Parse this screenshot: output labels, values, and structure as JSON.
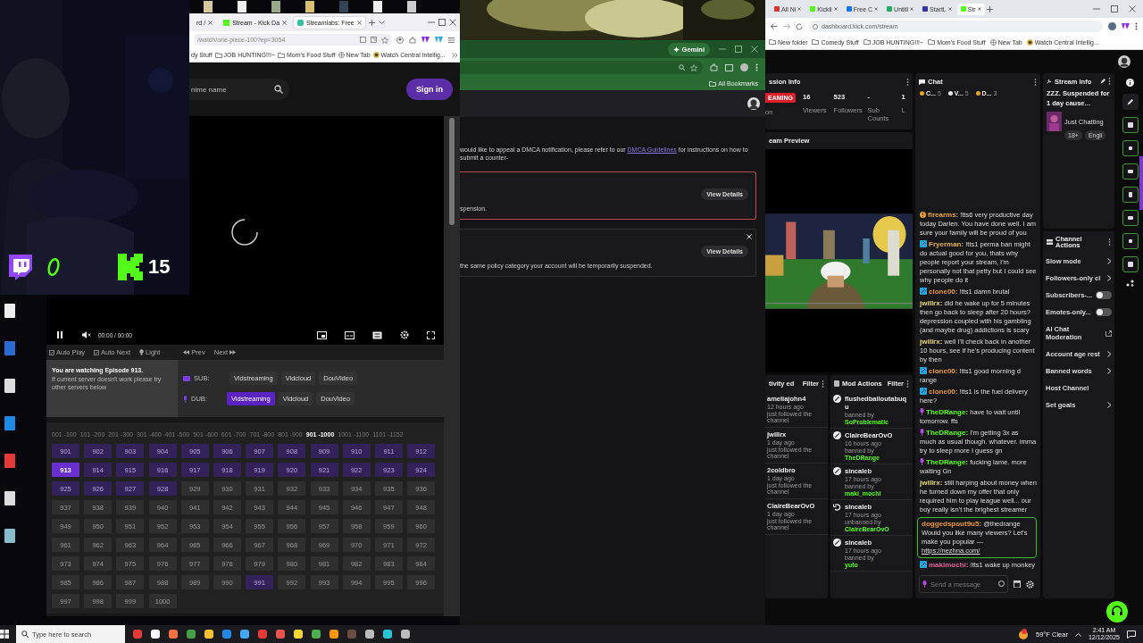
{
  "overlay": {
    "count": "15"
  },
  "player": {
    "tabs": [
      {
        "label": "rd /",
        "selected": false
      },
      {
        "label": "Stream - Kick Da",
        "selected": false
      },
      {
        "label": "Streamlabs: Free",
        "selected": true
      }
    ],
    "url": "/watch/one-piece-100?ep=3054",
    "bookmarks": [
      {
        "label": "dy Stuff",
        "kind": "text"
      },
      {
        "label": "JOB HUNTING!!!~",
        "kind": "folder"
      },
      {
        "label": "Mom's Food Stuff",
        "kind": "folder"
      },
      {
        "label": "New Tab",
        "kind": "globe"
      },
      {
        "label": "Watch Central Intellig...",
        "kind": "site"
      }
    ],
    "search": {
      "placeholder": "nime name"
    },
    "sign_in": "Sign in",
    "time": "00:00 / 00:00",
    "toolbar": [
      {
        "label": "Auto Play",
        "kind": "check"
      },
      {
        "label": "Auto Next",
        "kind": "check"
      },
      {
        "label": "Light",
        "kind": "bulb"
      },
      {
        "label": "Prev",
        "kind": "prev"
      },
      {
        "label": "Next",
        "kind": "next"
      }
    ],
    "notice": {
      "title": "You are watching Episode 913.",
      "text": "If current server doesn't work please try other servers below"
    },
    "servers": [
      {
        "kind": "sub",
        "label": "SUB:",
        "options": [
          {
            "label": "Vidstreaming",
            "selected": false
          },
          {
            "label": "Vidcloud",
            "selected": false
          },
          {
            "label": "DouVideo",
            "selected": false
          }
        ]
      },
      {
        "kind": "dub",
        "label": "DUB:",
        "options": [
          {
            "label": "Vidstreaming",
            "selected": true
          },
          {
            "label": "Vidcloud",
            "selected": false
          },
          {
            "label": "DouVideo",
            "selected": false
          }
        ]
      }
    ],
    "ranges": [
      {
        "label": "001 -100",
        "selected": false
      },
      {
        "label": "101 -200",
        "selected": false
      },
      {
        "label": "201 -300",
        "selected": false
      },
      {
        "label": "301 -400",
        "selected": false
      },
      {
        "label": "401 -500",
        "selected": false
      },
      {
        "label": "501 -600",
        "selected": false
      },
      {
        "label": "601 -700",
        "selected": false
      },
      {
        "label": "701 -800",
        "selected": false
      },
      {
        "label": "801 -900",
        "selected": false
      },
      {
        "label": "901 -1000",
        "selected": true
      },
      {
        "label": "1001 -1100",
        "selected": false
      },
      {
        "label": "1101 -1152",
        "selected": false
      }
    ],
    "episodes": [
      {
        "label": "901",
        "watched": true,
        "selected": false
      },
      {
        "label": "902",
        "watched": true,
        "selected": false
      },
      {
        "label": "903",
        "watched": true,
        "selected": false
      },
      {
        "label": "904",
        "watched": true,
        "selected": false
      },
      {
        "label": "905",
        "watched": true,
        "selected": false
      },
      {
        "label": "906",
        "watched": true,
        "selected": false
      },
      {
        "label": "907",
        "watched": true,
        "selected": false
      },
      {
        "label": "908",
        "watched": true,
        "selected": false
      },
      {
        "label": "909",
        "watched": true,
        "selected": false
      },
      {
        "label": "910",
        "watched": true,
        "selected": false
      },
      {
        "label": "911",
        "watched": true,
        "selected": false
      },
      {
        "label": "912",
        "watched": true,
        "selected": false
      },
      {
        "label": "913",
        "watched": true,
        "selected": true
      },
      {
        "label": "914",
        "watched": true,
        "selected": false
      },
      {
        "label": "915",
        "watched": true,
        "selected": false
      },
      {
        "label": "916",
        "watched": true,
        "selected": false
      },
      {
        "label": "917",
        "watched": true,
        "selected": false
      },
      {
        "label": "918",
        "watched": true,
        "selected": false
      },
      {
        "label": "919",
        "watched": true,
        "selected": false
      },
      {
        "label": "920",
        "watched": true,
        "selected": false
      },
      {
        "label": "921",
        "watched": true,
        "selected": false
      },
      {
        "label": "922",
        "watched": true,
        "selected": false
      },
      {
        "label": "923",
        "watched": true,
        "selected": false
      },
      {
        "label": "924",
        "watched": true,
        "selected": false
      },
      {
        "label": "925",
        "watched": true,
        "selected": false
      },
      {
        "label": "926",
        "watched": true,
        "selected": false
      },
      {
        "label": "927",
        "watched": true,
        "selected": false
      },
      {
        "label": "928",
        "watched": true,
        "selected": false
      },
      {
        "label": "929",
        "watched": false,
        "selected": false
      },
      {
        "label": "930",
        "watched": false,
        "selected": false
      },
      {
        "label": "931",
        "watched": false,
        "selected": false
      },
      {
        "label": "932",
        "watched": false,
        "selected": false
      },
      {
        "label": "933",
        "watched": false,
        "selected": false
      },
      {
        "label": "934",
        "watched": false,
        "selected": false
      },
      {
        "label": "935",
        "watched": false,
        "selected": false
      },
      {
        "label": "936",
        "watched": false,
        "selected": false
      },
      {
        "label": "937",
        "watched": false,
        "selected": false
      },
      {
        "label": "938",
        "watched": false,
        "selected": false
      },
      {
        "label": "939",
        "watched": false,
        "selected": false
      },
      {
        "label": "940",
        "watched": false,
        "selected": false
      },
      {
        "label": "941",
        "watched": false,
        "selected": false
      },
      {
        "label": "942",
        "watched": false,
        "selected": false
      },
      {
        "label": "943",
        "watched": false,
        "selected": false
      },
      {
        "label": "944",
        "watched": false,
        "selected": false
      },
      {
        "label": "945",
        "watched": false,
        "selected": false
      },
      {
        "label": "946",
        "watched": false,
        "selected": false
      },
      {
        "label": "947",
        "watched": false,
        "selected": false
      },
      {
        "label": "948",
        "watched": false,
        "selected": false
      },
      {
        "label": "949",
        "watched": false,
        "selected": false
      },
      {
        "label": "950",
        "watched": false,
        "selected": false
      },
      {
        "label": "951",
        "watched": false,
        "selected": false
      },
      {
        "label": "952",
        "watched": false,
        "selected": false
      },
      {
        "label": "953",
        "watched": false,
        "selected": false
      },
      {
        "label": "954",
        "watched": false,
        "selected": false
      },
      {
        "label": "955",
        "watched": false,
        "selected": false
      },
      {
        "label": "956",
        "watched": false,
        "selected": false
      },
      {
        "label": "957",
        "watched": false,
        "selected": false
      },
      {
        "label": "958",
        "watched": false,
        "selected": false
      },
      {
        "label": "959",
        "watched": false,
        "selected": false
      },
      {
        "label": "960",
        "watched": false,
        "selected": false
      },
      {
        "label": "961",
        "watched": false,
        "selected": false
      },
      {
        "label": "962",
        "watched": false,
        "selected": false
      },
      {
        "label": "963",
        "watched": false,
        "selected": false
      },
      {
        "label": "964",
        "watched": false,
        "selected": false
      },
      {
        "label": "965",
        "watched": false,
        "selected": false
      },
      {
        "label": "966",
        "watched": false,
        "selected": false
      },
      {
        "label": "967",
        "watched": false,
        "selected": false
      },
      {
        "label": "968",
        "watched": false,
        "selected": false
      },
      {
        "label": "969",
        "watched": false,
        "selected": false
      },
      {
        "label": "970",
        "watched": false,
        "selected": false
      },
      {
        "label": "971",
        "watched": false,
        "selected": false
      },
      {
        "label": "972",
        "watched": false,
        "selected": false
      },
      {
        "label": "973",
        "watched": false,
        "selected": false
      },
      {
        "label": "974",
        "watched": false,
        "selected": false
      },
      {
        "label": "975",
        "watched": false,
        "selected": false
      },
      {
        "label": "976",
        "watched": false,
        "selected": false
      },
      {
        "label": "977",
        "watched": false,
        "selected": false
      },
      {
        "label": "978",
        "watched": false,
        "selected": false
      },
      {
        "label": "979",
        "watched": false,
        "selected": false
      },
      {
        "label": "980",
        "watched": false,
        "selected": false
      },
      {
        "label": "981",
        "watched": false,
        "selected": false
      },
      {
        "label": "982",
        "watched": false,
        "selected": false
      },
      {
        "label": "983",
        "watched": false,
        "selected": false
      },
      {
        "label": "984",
        "watched": false,
        "selected": false
      },
      {
        "label": "985",
        "watched": false,
        "selected": false
      },
      {
        "label": "986",
        "watched": false,
        "selected": false
      },
      {
        "label": "987",
        "watched": false,
        "selected": false
      },
      {
        "label": "988",
        "watched": false,
        "selected": false
      },
      {
        "label": "989",
        "watched": false,
        "selected": false
      },
      {
        "label": "990",
        "watched": false,
        "selected": false
      },
      {
        "label": "991",
        "watched": true,
        "selected": false
      },
      {
        "label": "992",
        "watched": false,
        "selected": false
      },
      {
        "label": "993",
        "watched": false,
        "selected": false
      },
      {
        "label": "994",
        "watched": false,
        "selected": false
      },
      {
        "label": "995",
        "watched": false,
        "selected": false
      },
      {
        "label": "996",
        "watched": false,
        "selected": false
      },
      {
        "label": "997",
        "watched": false,
        "selected": false
      },
      {
        "label": "998",
        "watched": false,
        "selected": false
      },
      {
        "label": "999",
        "watched": false,
        "selected": false
      },
      {
        "label": "1000",
        "watched": false,
        "selected": false
      }
    ]
  },
  "dashboard": {
    "gemini": "Gemini",
    "all_bookmarks": "All Bookmarks",
    "notice": "would like to appeal a DMCA notification, please refer to our ",
    "notice_link": "DMCA Guidelines",
    "notice_after": " for instructions on how to submit a counter-",
    "cards": [
      {
        "kind": "alert",
        "button": "View Details",
        "text": "spension.",
        "dismissible": false
      },
      {
        "kind": "warning",
        "button": "View Details",
        "text": "the same policy category your account will be temporarily suspended.",
        "dismissible": true
      }
    ]
  },
  "kick": {
    "tabs": [
      {
        "label": "All Ni",
        "selected": false
      },
      {
        "label": "Kickli",
        "selected": false
      },
      {
        "label": "Free C",
        "selected": false
      },
      {
        "label": "Untitl",
        "selected": false
      },
      {
        "label": "StartL",
        "selected": false
      },
      {
        "label": "Str",
        "selected": true
      }
    ],
    "url": "dashboard.kick.com/stream",
    "bookmarks": [
      {
        "label": "New folder",
        "kind": "folder"
      },
      {
        "label": "Comedy Stuff",
        "kind": "folder"
      },
      {
        "label": "JOB HUNTING!!!~",
        "kind": "folder"
      },
      {
        "label": "Mom's Food Stuff",
        "kind": "folder"
      },
      {
        "label": "New Tab",
        "kind": "globe"
      },
      {
        "label": "Watch Central Intellig...",
        "kind": "site"
      }
    ],
    "session": {
      "title": "ssion Info",
      "badge": "EAMING",
      "badge_sub": "on",
      "stats": [
        {
          "value": "16",
          "label": "Viewers"
        },
        {
          "value": "523",
          "label": "Followers"
        },
        {
          "value": "-",
          "label": "Sub Counts"
        },
        {
          "value": "1",
          "label": "L"
        }
      ]
    },
    "preview_title": "eam Preview",
    "activity": {
      "title": "tivity ed",
      "filter": "Filter",
      "items": [
        {
          "user": "ameliajohn4",
          "time": "12 hours ago",
          "text": "just followed the channel"
        },
        {
          "user": "jwillrx",
          "time": "1 day ago",
          "text": "just followed the channel"
        },
        {
          "user": "2coldbro",
          "time": "1 day ago",
          "text": "just followed the channel"
        },
        {
          "user": "ClaireBearOvO",
          "time": "1 day ago",
          "text": "just followed the channel"
        }
      ]
    },
    "mod_actions": {
      "title": "Mod Actions",
      "filter": "Filter",
      "items": [
        {
          "kind": "ban",
          "user": "flushedbailoutabuqu",
          "action": "banned by",
          "by": "SoProblematic"
        },
        {
          "kind": "ban",
          "user": "ClaireBearOvO",
          "time": "16 hours ago",
          "action": "banned by",
          "by": "TheDRange"
        },
        {
          "kind": "ban",
          "user": "sincaleb",
          "time": "17 hours ago",
          "action": "banned by",
          "by": "maki_mochi"
        },
        {
          "kind": "unban",
          "user": "sincaleb",
          "time": "17 hours ago",
          "action": "unbanned by",
          "by": "ClaireBearOvO"
        },
        {
          "kind": "ban",
          "user": "sincaleb",
          "time": "17 hours ago",
          "action": "banned by",
          "by": "yuto"
        }
      ]
    },
    "chat": {
      "title": "Chat",
      "filters": [
        {
          "label": "C...",
          "count": "5",
          "color": "#e8a020"
        },
        {
          "label": "V...",
          "count": "5",
          "color": "#e6e6e6"
        },
        {
          "label": "D...",
          "count": "3",
          "color": "#e8a020"
        }
      ],
      "messages": [
        {
          "kind": "warn",
          "user": "firearms:",
          "color": "#e8a83a",
          "text": "!tts6 very productive day today Darlen. You have done well. I am sure your family will be proud of you",
          "highlighted": false
        },
        {
          "kind": "mod",
          "user": "Fryerman:",
          "color": "#e0b050",
          "text": "!tts1 perma ban might do actual good for you, thats why people report your stream, I'm personally not that petty but I could see why people do it",
          "highlighted": false
        },
        {
          "kind": "mod",
          "user": "clone00:",
          "color": "#e8963a",
          "text": "!tts1 damn brutal",
          "highlighted": false
        },
        {
          "kind": "none",
          "user": "jwillrx:",
          "color": "#e8d878",
          "text": "did he wake up for 5 minutes then go back to sleep after 20 hours? depression coupled with his gambling (and maybe drug) addictions is scary",
          "highlighted": false
        },
        {
          "kind": "none",
          "user": "jwillrx:",
          "color": "#e8d878",
          "text": "well I'll check back in another 10 hours, see if he's producing content by then",
          "highlighted": false
        },
        {
          "kind": "mod",
          "user": "clone00:",
          "color": "#e8963a",
          "text": "!tts1 good morning d range",
          "highlighted": false
        },
        {
          "kind": "mod",
          "user": "clone00:",
          "color": "#e8963a",
          "text": "!tts1 is the fuel delivery here?",
          "highlighted": false
        },
        {
          "kind": "mic",
          "user": "TheDRange:",
          "color": "#53fc18",
          "text": "have to wait until tomorrow. ffs",
          "highlighted": false
        },
        {
          "kind": "mic",
          "user": "TheDRange:",
          "color": "#53fc18",
          "text": "I'm getting 3x as much as usual though. whatever. imma try to sleep more I guess gn",
          "highlighted": false
        },
        {
          "kind": "mic",
          "user": "TheDRange:",
          "color": "#53fc18",
          "text": "fucking lame. more waiting Gn",
          "highlighted": false
        },
        {
          "kind": "none",
          "user": "jwillrx:",
          "color": "#e8d878",
          "text": "still harping about money when he turned down my offer that only required him to play league well... our boy really isn't the brighest streamer",
          "highlighted": false
        },
        {
          "kind": "none",
          "user": "doggedspout9u5:",
          "color": "#e8963a",
          "text": "@thedrange Would you like many viewers? Let's make you popular — ",
          "link": "https://nezhna.com/",
          "highlighted": true
        },
        {
          "kind": "mod",
          "user": "makimochi:",
          "color": "#e0609a",
          "text": "!tts1 wake up monkey",
          "highlighted": false
        }
      ],
      "input": {
        "placeholder": "Send a message"
      }
    },
    "stream_info": {
      "title": "Stream Info",
      "stream_title": "ZZZ. Suspended for 1 day cause...",
      "category": "Just Chatting",
      "tags": [
        "18+",
        "Engli"
      ]
    },
    "channel_actions": {
      "title": "Channel Actions",
      "items": [
        {
          "label": "Slow mode",
          "kind": "link"
        },
        {
          "label": "Followers-only cl",
          "kind": "link"
        },
        {
          "label": "Subscribers-...",
          "kind": "toggle",
          "on": false
        },
        {
          "label": "Emotes-only...",
          "kind": "toggle",
          "on": false
        },
        {
          "label": "AI Chat Moderation",
          "kind": "external"
        },
        {
          "label": "Account age rest",
          "kind": "link"
        },
        {
          "label": "Banned words",
          "kind": "link"
        },
        {
          "label": "Host Channel",
          "kind": "plain"
        },
        {
          "label": "Set goals",
          "kind": "link"
        }
      ]
    }
  },
  "taskbar": {
    "search": {
      "placeholder": "Type here to search"
    },
    "weather": "59°F Clear",
    "time": "2:41 AM",
    "date": "12/12/2025"
  }
}
